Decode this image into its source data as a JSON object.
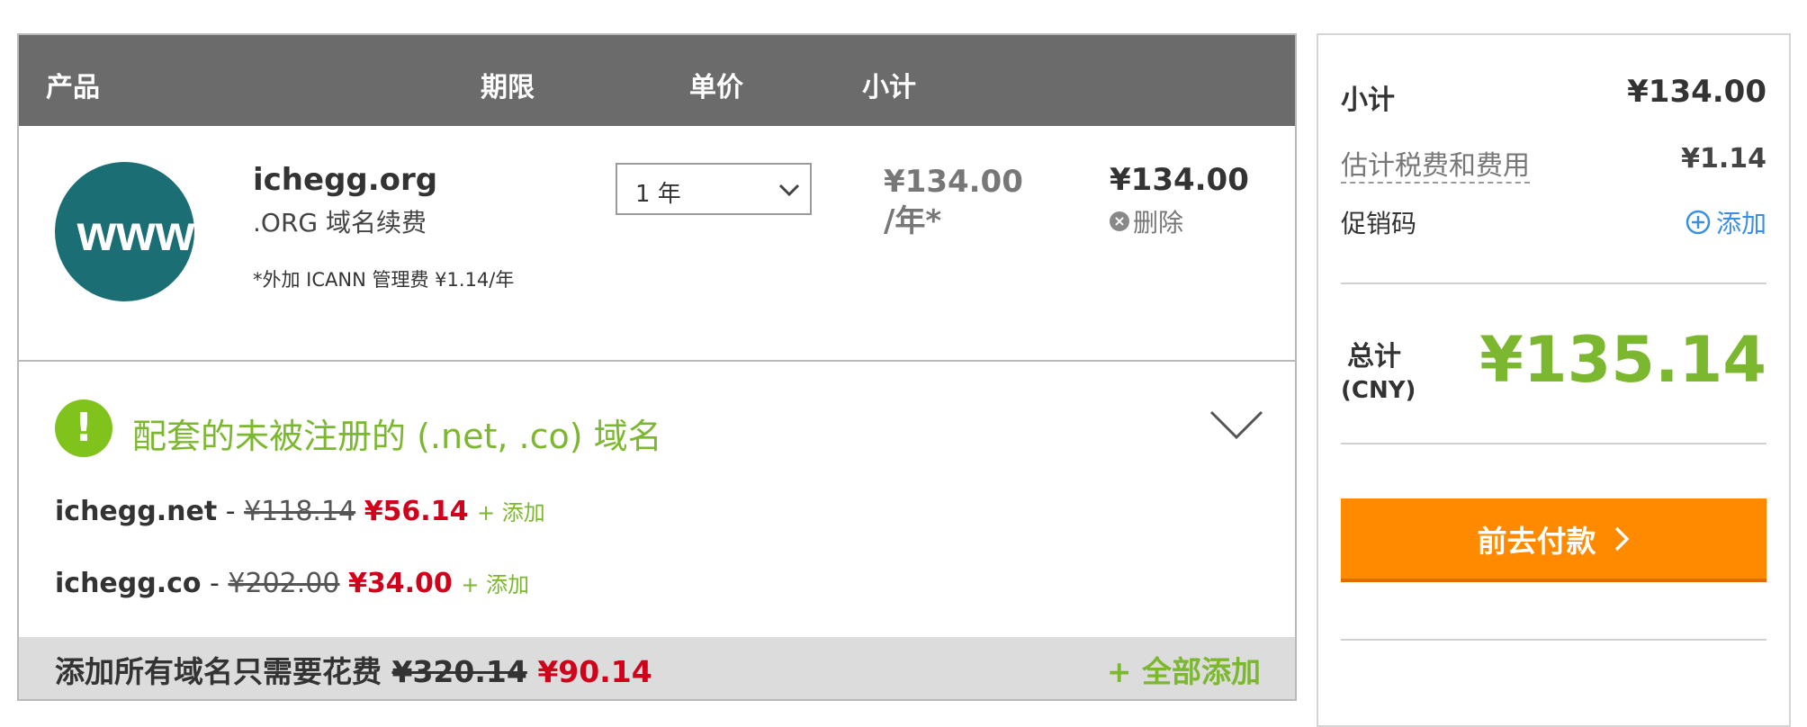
{
  "table": {
    "headers": {
      "product": "产品",
      "term": "期限",
      "unit_price": "单价",
      "subtotal": "小计"
    }
  },
  "item": {
    "logo_text": "www",
    "domain": "ichegg.org",
    "description": ".ORG 域名续费",
    "note": "*外加 ICANN 管理费 ¥1.14/年",
    "term_value": "1 年",
    "unit_price": "¥134.00",
    "unit_suffix": "/年*",
    "subtotal": "¥134.00",
    "remove_label": "删除"
  },
  "promo": {
    "title": "配套的未被注册的 (.net, .co) 域名",
    "items": [
      {
        "name": "ichegg.net",
        "sep": " - ",
        "old_price": "¥118.14",
        "new_price": "¥56.14",
        "add_label": "+ 添加"
      },
      {
        "name": "ichegg.co",
        "sep": " - ",
        "old_price": "¥202.00",
        "new_price": "¥34.00",
        "add_label": "+ 添加"
      }
    ],
    "bundle_text": "添加所有域名只需要花费",
    "bundle_old": "¥320.14",
    "bundle_new": "¥90.14",
    "add_all": "+ 全部添加"
  },
  "summary": {
    "subtotal_label": "小计",
    "subtotal_value": "¥134.00",
    "tax_label": "估计税费和费用",
    "tax_value": "¥1.14",
    "promo_label": "促销码",
    "promo_add": "添加",
    "total_label": "总计",
    "currency": "(CNY)",
    "total_value": "¥135.14",
    "checkout_label": "前去付款"
  },
  "colors": {
    "header_bg": "#6b6b6b",
    "accent_green": "#7cb82f",
    "price_red": "#d0021b",
    "checkout_orange": "#ff8a00",
    "link_blue": "#3b8fe0",
    "logo_teal": "#1b6e73"
  }
}
